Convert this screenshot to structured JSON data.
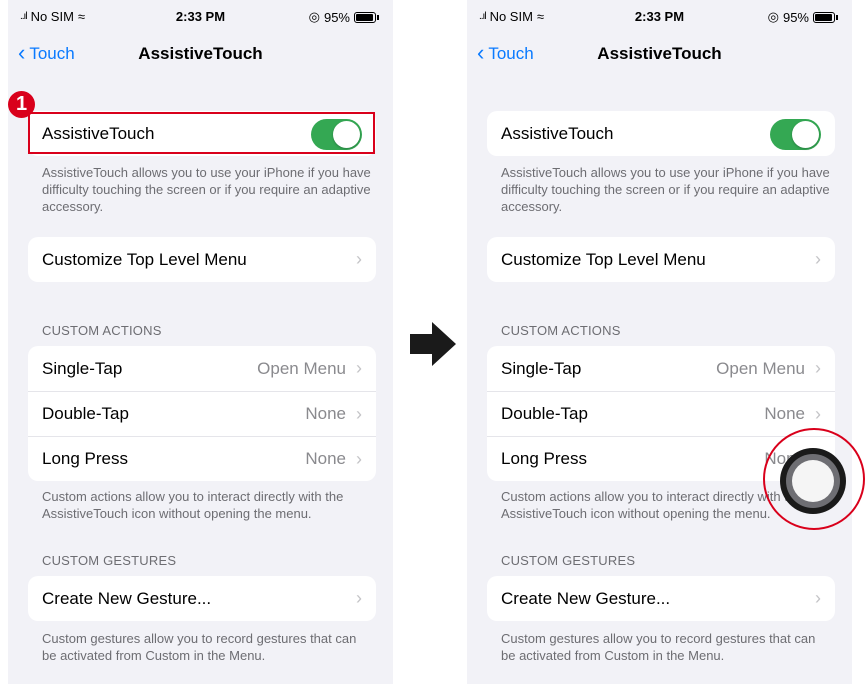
{
  "status_bar": {
    "carrier": "No SIM",
    "time": "2:33 PM",
    "battery": "95%"
  },
  "nav": {
    "back_label": "Touch",
    "title": "AssistiveTouch"
  },
  "assistive": {
    "label": "AssistiveTouch",
    "enabled": true,
    "footnote": "AssistiveTouch allows you to use your iPhone if you have difficulty touching the screen or if you require an adaptive accessory."
  },
  "customize": {
    "label": "Customize Top Level Menu"
  },
  "custom_actions": {
    "header": "CUSTOM ACTIONS",
    "rows": [
      {
        "label": "Single-Tap",
        "value": "Open Menu"
      },
      {
        "label": "Double-Tap",
        "value": "None"
      },
      {
        "label": "Long Press",
        "value": "None"
      }
    ],
    "footnote": "Custom actions allow you to interact directly with the AssistiveTouch icon without opening the menu."
  },
  "custom_gestures": {
    "header": "CUSTOM GESTURES",
    "create_label": "Create New Gesture...",
    "footnote": "Custom gestures allow you to record gestures that can be activated from Custom in the Menu."
  },
  "annotations": {
    "step_number": "1",
    "highlight_color": "#d9001b"
  },
  "colors": {
    "accent": "#0a7aff",
    "toggle_on": "#34a853",
    "background": "#f2f2f7"
  },
  "icons": [
    "wifi-icon",
    "alarm-icon",
    "battery-icon",
    "chevron-left-icon",
    "chevron-right-icon",
    "arrow-right-icon",
    "assistivetouch-icon"
  ]
}
